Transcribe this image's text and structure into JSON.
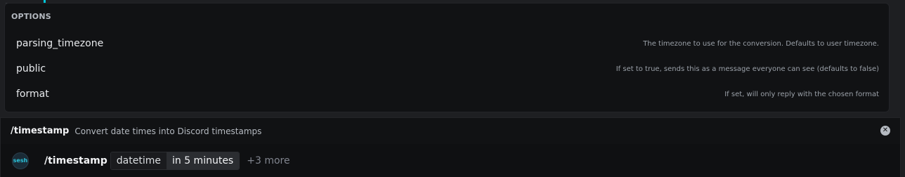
{
  "options": {
    "header": "OPTIONS",
    "items": [
      {
        "name": "parsing_timezone",
        "description": "The timezone to use for the conversion. Defaults to user timezone."
      },
      {
        "name": "public",
        "description": "If set to true, sends this as a message everyone can see (defaults to false)"
      },
      {
        "name": "format",
        "description": "If set, will only reply with the chosen format"
      }
    ]
  },
  "command": {
    "name": "/timestamp",
    "description": "Convert date times into Discord timestamps",
    "close_icon": "close-circle-icon"
  },
  "input": {
    "avatar_text": "sesh",
    "command": "/timestamp",
    "param_key": "datetime",
    "param_value": "in 5 minutes",
    "more": "+3 more"
  },
  "colors": {
    "accent": "#00c6d8",
    "background": "#1e1f22",
    "panel": "#111214"
  }
}
